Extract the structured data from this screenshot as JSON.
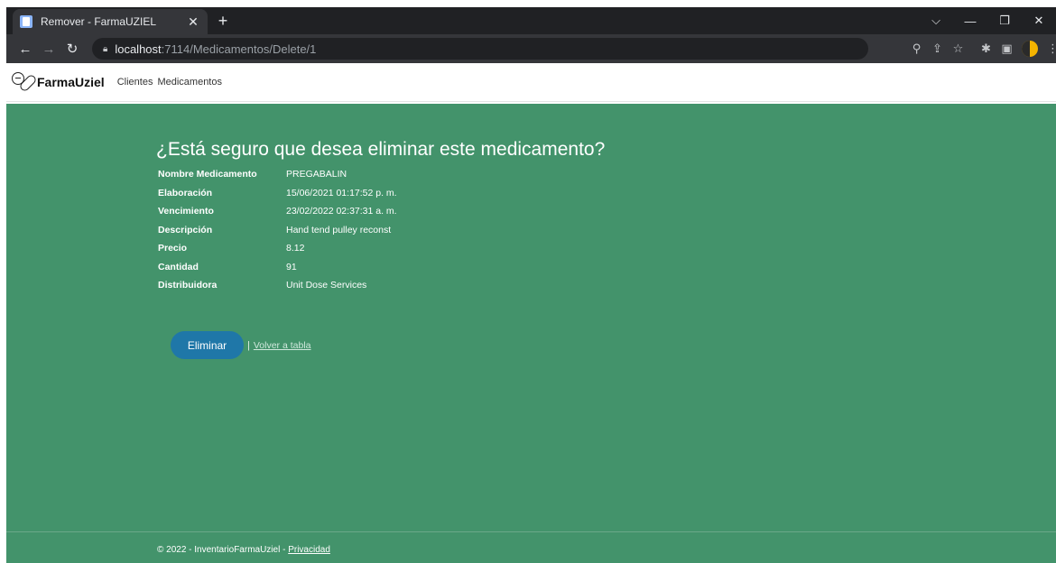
{
  "browser": {
    "tab_title": "Remover - FarmaUZIEL",
    "tab_close": "✕",
    "new_tab": "+",
    "url_host": "localhost",
    "url_rest": ":7114/Medicamentos/Delete/1",
    "window_controls": {
      "dropdown": "⌵",
      "minimize": "—",
      "restore": "❐",
      "close": "✕"
    },
    "icons": [
      "back-arrow-icon",
      "forward-arrow-icon",
      "reload-icon",
      "lock-icon",
      "zoom-icon",
      "share-icon",
      "star-icon",
      "extensions-icon",
      "sidepanel-icon",
      "profile-icon",
      "menu-icon"
    ]
  },
  "navbar": {
    "brand": "FarmaUziel",
    "links": [
      "Clientes",
      "Medicamentos"
    ]
  },
  "main": {
    "heading": "¿Está seguro que desea eliminar este medicamento?",
    "details": [
      {
        "label": "Nombre Medicamento",
        "value": "PREGABALIN"
      },
      {
        "label": "Elaboración",
        "value": "15/06/2021 01:17:52 p. m."
      },
      {
        "label": "Vencimiento",
        "value": "23/02/2022 02:37:31 a. m."
      },
      {
        "label": "Descripción",
        "value": "Hand tend pulley reconst"
      },
      {
        "label": "Precio",
        "value": "8.12"
      },
      {
        "label": "Cantidad",
        "value": "91"
      },
      {
        "label": "Distribuidora",
        "value": "Unit Dose Services"
      }
    ],
    "delete_button": "Eliminar",
    "separator": "|",
    "back_link": "Volver a tabla"
  },
  "footer": {
    "text": "© 2022 - InventarioFarmaUziel - ",
    "privacy_link": "Privacidad"
  },
  "colors": {
    "page_background": "#43936b",
    "delete_button": "#1f77a8",
    "browser_dark": "#202124",
    "browser_toolbar": "#35363a"
  }
}
